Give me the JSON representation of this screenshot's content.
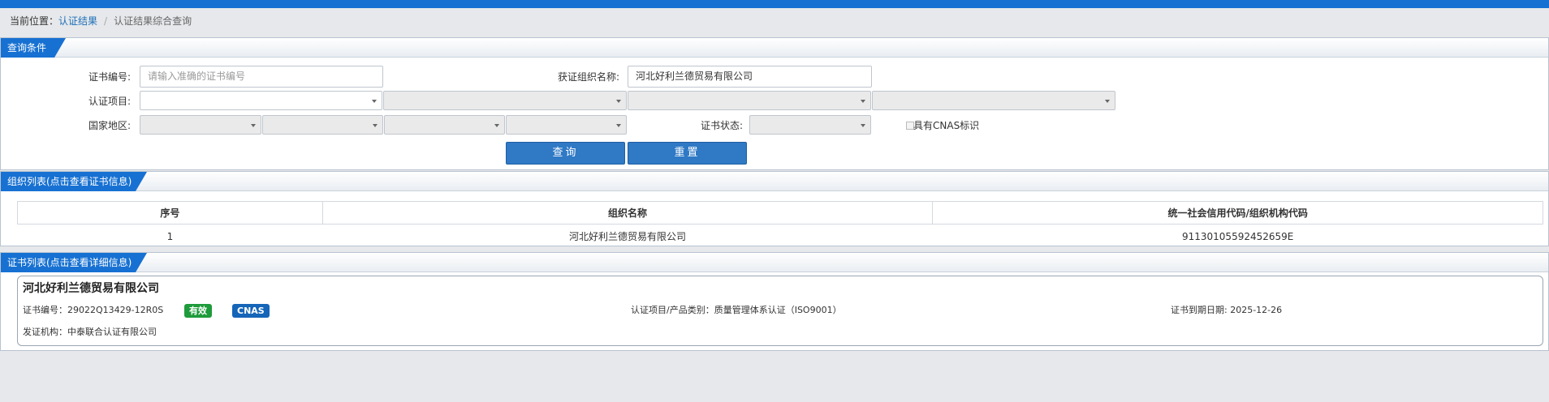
{
  "breadcrumb": {
    "prefix": "当前位置：",
    "link": "认证结果",
    "separator": "/",
    "current": "认证结果综合查询"
  },
  "query_panel": {
    "title": "查询条件",
    "cert_no_label": "证书编号:",
    "cert_no_placeholder": "请输入准确的证书编号",
    "org_name_label": "获证组织名称:",
    "org_name_value": "河北好利兰德贸易有限公司",
    "cert_item_label": "认证项目:",
    "country_label": "国家地区:",
    "status_label": "证书状态:",
    "cnas_label": "具有CNAS标识",
    "search_button": "查询",
    "reset_button": "重置"
  },
  "org_panel": {
    "title": "组织列表(点击查看证书信息)",
    "columns": [
      "序号",
      "组织名称",
      "统一社会信用代码/组织机构代码"
    ],
    "rows": [
      [
        "1",
        "河北好利兰德贸易有限公司",
        "91130105592452659E"
      ]
    ]
  },
  "cert_panel": {
    "title": "证书列表(点击查看详细信息)",
    "card": {
      "org_name": "河北好利兰德贸易有限公司",
      "cert_no": "证书编号：29022Q13429-12R0S",
      "status_badge": "有效",
      "cnas_badge": "CNAS",
      "category": "认证项目/产品类别：质量管理体系认证（ISO9001）",
      "expiry": "证书到期日期: 2025-12-26",
      "issuer": "发证机构：中泰联合认证有限公司"
    }
  },
  "colors": {
    "accent": "#1771d2",
    "button": "#2f79c5",
    "badge_valid": "#1e9b3a",
    "badge_cnas": "#1565b8"
  }
}
